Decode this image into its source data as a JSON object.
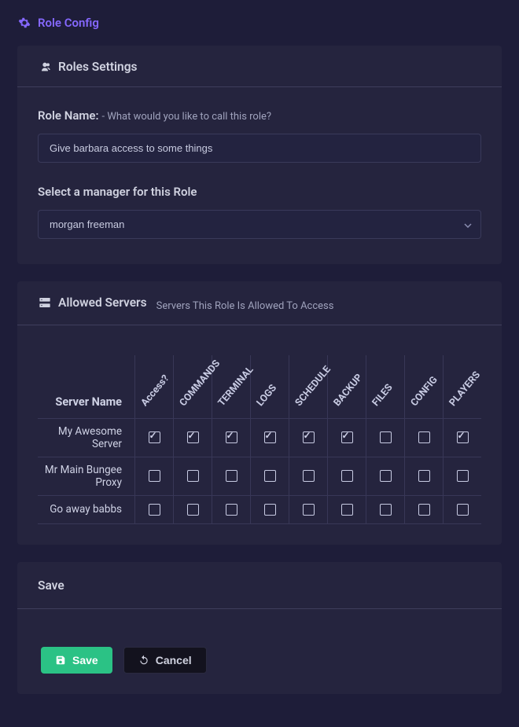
{
  "page": {
    "title": "Role Config"
  },
  "roles_section": {
    "title": "Roles Settings",
    "role_name_label": "Role Name:",
    "role_name_hint": "- What would you like to call this role?",
    "role_name_value": "Give barbara access to some things",
    "manager_label": "Select a manager for this Role",
    "manager_value": "morgan freeman"
  },
  "allowed": {
    "title": "Allowed Servers",
    "subtitle": "Servers This Role Is Allowed To Access",
    "server_header": "Server Name",
    "cols": [
      "Access?",
      "COMMANDS",
      "TERMINAL",
      "LOGS",
      "SCHEDULE",
      "BACKUP",
      "FILES",
      "CONFIG",
      "PLAYERS"
    ],
    "rows": [
      {
        "name": "My Awesome Server",
        "cells": [
          true,
          true,
          true,
          true,
          true,
          true,
          false,
          false,
          true
        ]
      },
      {
        "name": "Mr Main Bungee Proxy",
        "cells": [
          false,
          false,
          false,
          false,
          false,
          false,
          false,
          false,
          false
        ]
      },
      {
        "name": "Go away babbs",
        "cells": [
          false,
          false,
          false,
          false,
          false,
          false,
          false,
          false,
          false
        ]
      }
    ]
  },
  "save": {
    "title": "Save",
    "save_label": "Save",
    "cancel_label": "Cancel"
  }
}
